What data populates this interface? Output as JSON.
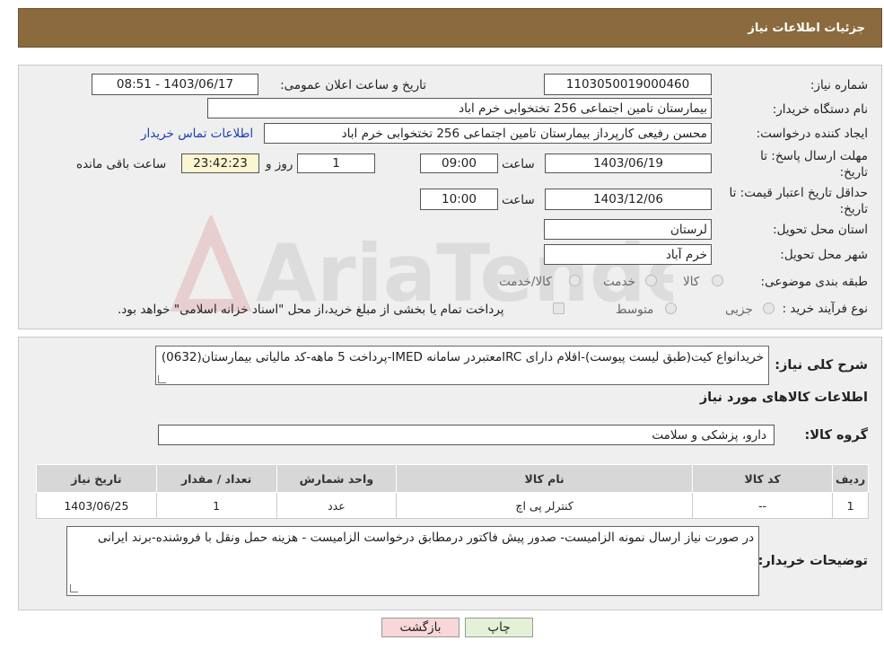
{
  "header": {
    "title": "جزئیات اطلاعات نیاز"
  },
  "form": {
    "need_number_label": "شماره نیاز:",
    "need_number": "1103050019000460",
    "announce_datetime_label": "تاریخ و ساعت اعلان عمومی:",
    "announce_datetime": "1403/06/17 - 08:51",
    "buyer_org_label": "نام دستگاه خریدار:",
    "buyer_org": "بیمارستان تامین اجتماعی  256 تختخوابی خرم اباد",
    "requester_label": "ایجاد کننده درخواست:",
    "requester": "محسن رفیعی کارپرداز بیمارستان تامین اجتماعی  256 تختخوابی خرم اباد",
    "contact_link": "اطلاعات تماس خریدار",
    "reply_deadline_label_1": "مهلت ارسال پاسخ: تا",
    "reply_deadline_label_2": "تاریخ:",
    "reply_date": "1403/06/19",
    "time_label": "ساعت",
    "reply_time": "09:00",
    "days_value": "1",
    "days_label": "روز و",
    "remaining_value": "23:42:23",
    "remaining_label": "ساعت باقی مانده",
    "price_validity_label_1": "حداقل تاریخ اعتبار قیمت: تا",
    "price_validity_label_2": "تاریخ:",
    "validity_date": "1403/12/06",
    "validity_time": "10:00",
    "province_label": "استان محل تحویل:",
    "province": "لرستان",
    "city_label": "شهر محل تحویل:",
    "city": "خرم آباد",
    "category_label": "طبقه بندی موضوعی:",
    "category_options": [
      "کالا",
      "خدمت",
      "کالا/خدمت"
    ],
    "process_label": "نوع فرآیند خرید :",
    "process_options": [
      "جزیی",
      "متوسط"
    ],
    "payment_note": "پرداخت تمام یا بخشی از مبلغ خرید،از محل \"اسناد خزانه اسلامی\" خواهد بود."
  },
  "details": {
    "description_label": "شرح کلی نیاز:",
    "description": "خریدانواع کیت(طبق لیست پیوست)-اقلام دارای IRCمعتبردر سامانه IMED-پرداخت 5 ماهه-کد مالیاتی بیمارستان(0632)",
    "items_title": "اطلاعات کالاهای مورد نیاز",
    "group_label": "گروه کالا:",
    "group_value": "دارو، پزشکی و سلامت",
    "table": {
      "headers": [
        "ردیف",
        "کد کالا",
        "نام کالا",
        "واحد شمارش",
        "تعداد / مقدار",
        "تاریخ نیاز"
      ],
      "rows": [
        [
          "1",
          "--",
          "کنترلر پی اچ",
          "عدد",
          "1",
          "1403/06/25"
        ]
      ]
    },
    "buyer_notes_label": "توضیحات خریدار:",
    "buyer_notes": "در صورت نیاز ارسال نمونه الزامیست- صدور پیش فاکتور درمطابق درخواست الزامیست - هزینه حمل ونقل با فروشنده-برند ایرانی"
  },
  "buttons": {
    "print": "چاپ",
    "back": "بازگشت"
  },
  "colors": {
    "header": "#8b6b3e",
    "back_button": "#f7d7d7",
    "print_button": "#e3f2d6",
    "link": "#1a3fb3"
  }
}
